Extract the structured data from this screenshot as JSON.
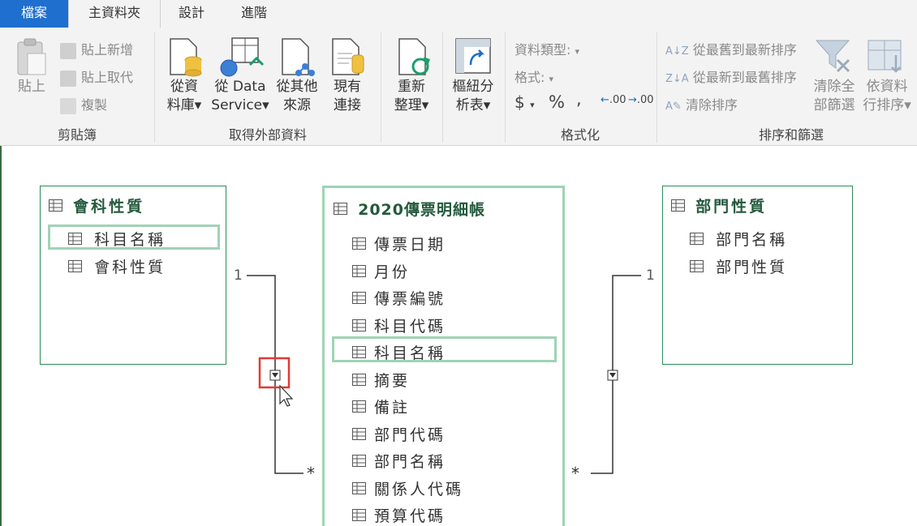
{
  "tabs": [
    "檔案",
    "主資料夾",
    "設計",
    "進階"
  ],
  "clipboard": {
    "paste": "貼上",
    "paste_append": "貼上新增",
    "paste_replace": "貼上取代",
    "copy": "複製",
    "group": "剪貼簿"
  },
  "external": {
    "from_db_1": "從資",
    "from_db_2": "料庫",
    "from_service_1": "從 Data",
    "from_service_2": "Service",
    "from_other_1": "從其他",
    "from_other_2": "來源",
    "existing_1": "現有",
    "existing_2": "連接",
    "group": "取得外部資料"
  },
  "refresh": {
    "line1": "重新",
    "line2": "整理"
  },
  "pivot": {
    "line1": "樞紐分",
    "line2": "析表"
  },
  "formatting": {
    "data_type": "資料類型:",
    "format": "格式:",
    "currency": "$",
    "percent": "%",
    "comma": ",",
    "inc_dec": ".00",
    "dec_dec": ".00",
    "group": "格式化"
  },
  "sort": {
    "asc": "從最舊到最新排序",
    "desc": "從最新到最舊排序",
    "clear": "清除排序",
    "clear_all_1": "清除全",
    "clear_all_2": "部篩選",
    "by_col_1": "依資料",
    "by_col_2": "行排序",
    "group": "排序和篩選"
  },
  "tables": {
    "left": {
      "title": "會科性質",
      "columns": [
        "科目名稱",
        "會科性質"
      ]
    },
    "center": {
      "title": "2020傳票明細帳",
      "columns": [
        "傳票日期",
        "月份",
        "傳票編號",
        "科目代碼",
        "科目名稱",
        "摘要",
        "備註",
        "部門代碼",
        "部門名稱",
        "關係人代碼",
        "預算代碼"
      ]
    },
    "right": {
      "title": "部門性質",
      "columns": [
        "部門名稱",
        "部門性質"
      ]
    }
  },
  "relations": {
    "one": "1",
    "many": "*"
  }
}
